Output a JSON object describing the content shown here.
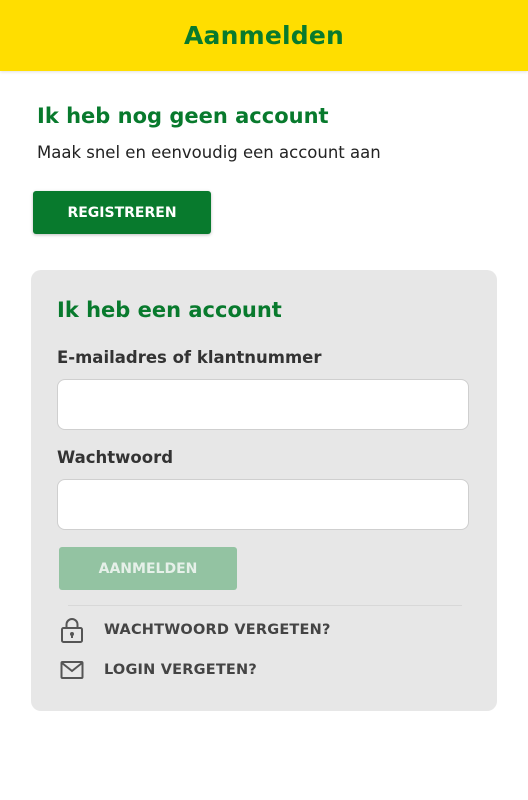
{
  "colors": {
    "header_bg": "#FFDE00",
    "brand_green": "#087A2D",
    "card_bg": "#E7E7E7",
    "disabled_button_bg": "#93C3A2"
  },
  "header": {
    "title": "Aanmelden"
  },
  "register_section": {
    "heading": "Ik heb nog geen account",
    "subtext": "Maak snel en eenvoudig een account aan",
    "button_label": "REGISTREREN"
  },
  "login_section": {
    "heading": "Ik heb een account",
    "email_label": "E-mailadres of klantnummer",
    "email_value": "",
    "password_label": "Wachtwoord",
    "password_value": "",
    "submit_label": "AANMELDEN",
    "links": [
      {
        "icon": "lock-icon",
        "label": "WACHTWOORD VERGETEN?"
      },
      {
        "icon": "envelope-icon",
        "label": "LOGIN VERGETEN?"
      }
    ]
  }
}
